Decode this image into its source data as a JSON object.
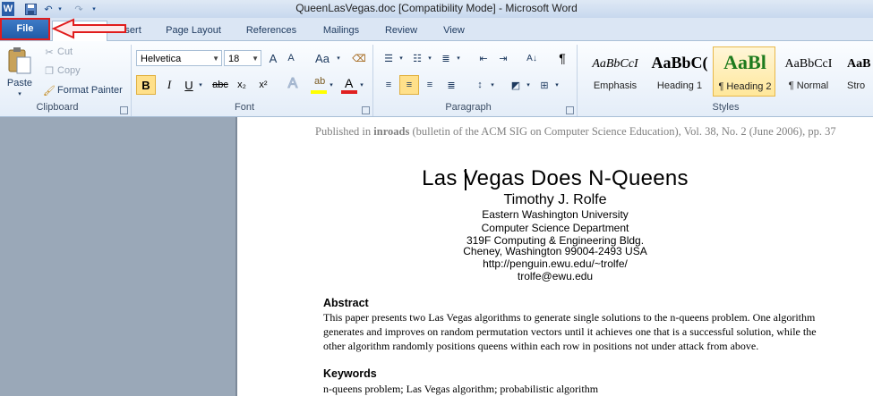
{
  "window": {
    "title": "QueenLasVegas.doc [Compatibility Mode]  -  Microsoft Word"
  },
  "qat": {
    "app_icon": "word-icon",
    "save_icon": "save-icon",
    "undo_icon": "undo-icon",
    "redo_icon": "redo-icon"
  },
  "tabs": [
    {
      "label": "File"
    },
    {
      "label": "Home"
    },
    {
      "label": "Insert"
    },
    {
      "label": "Page Layout"
    },
    {
      "label": "References"
    },
    {
      "label": "Mailings"
    },
    {
      "label": "Review"
    },
    {
      "label": "View"
    }
  ],
  "clipboard": {
    "paste_label": "Paste",
    "cut_label": "Cut",
    "copy_label": "Copy",
    "format_painter_label": "Format Painter",
    "group_label": "Clipboard"
  },
  "font": {
    "family": "Helvetica",
    "size": "18",
    "group_label": "Font",
    "bold": "B",
    "italic": "I",
    "underline": "U",
    "strike": "abc",
    "subscript": "x₂",
    "superscript": "x²",
    "grow": "A",
    "shrink": "A",
    "change_case": "Aa",
    "text_effects": "A",
    "font_color": "A"
  },
  "paragraph": {
    "group_label": "Paragraph",
    "show_marks": "¶"
  },
  "styles": {
    "group_label": "Styles",
    "items": [
      {
        "preview": "AaBbCcI",
        "name": "Emphasis"
      },
      {
        "preview": "AaBbC(",
        "name": "Heading 1"
      },
      {
        "preview": "AaBl",
        "name": "¶ Heading 2"
      },
      {
        "preview": "AaBbCcI",
        "name": "¶ Normal"
      },
      {
        "preview": "AaB",
        "name": "Stro"
      }
    ]
  },
  "document": {
    "publication_prefix": "Published in ",
    "publication_venue": "inroads",
    "publication_rest": " (bulletin of the ACM SIG on Computer Science Education), Vol. 38, No. 2 (June 2006), pp. 37",
    "title": "Las Vegas Does N-Queens",
    "author": "Timothy J. Rolfe",
    "affiliation_lines": [
      "Eastern Washington University",
      "Computer Science Department",
      "319F Computing & Engineering Bldg.",
      "Cheney, Washington 99004-2493 USA",
      "http://penguin.ewu.edu/~trolfe/",
      "trolfe@ewu.edu"
    ],
    "abstract_heading": "Abstract",
    "abstract_lines": [
      "This paper presents two Las Vegas algorithms to generate single solutions to the n-queens problem. One algorithm",
      "generates and improves on random permutation vectors until it achieves one that is a successful solution, while the",
      "other algorithm randomly positions queens within each row in positions not under attack from above."
    ],
    "keywords_heading": "Keywords",
    "keywords_text": "n-queens problem; Las Vegas algorithm; probabilistic algorithm"
  },
  "colors": {
    "file_tab": "#2a66b5",
    "annotation_red": "#e01c1c",
    "heading2_preview": "#1e7b1e"
  }
}
